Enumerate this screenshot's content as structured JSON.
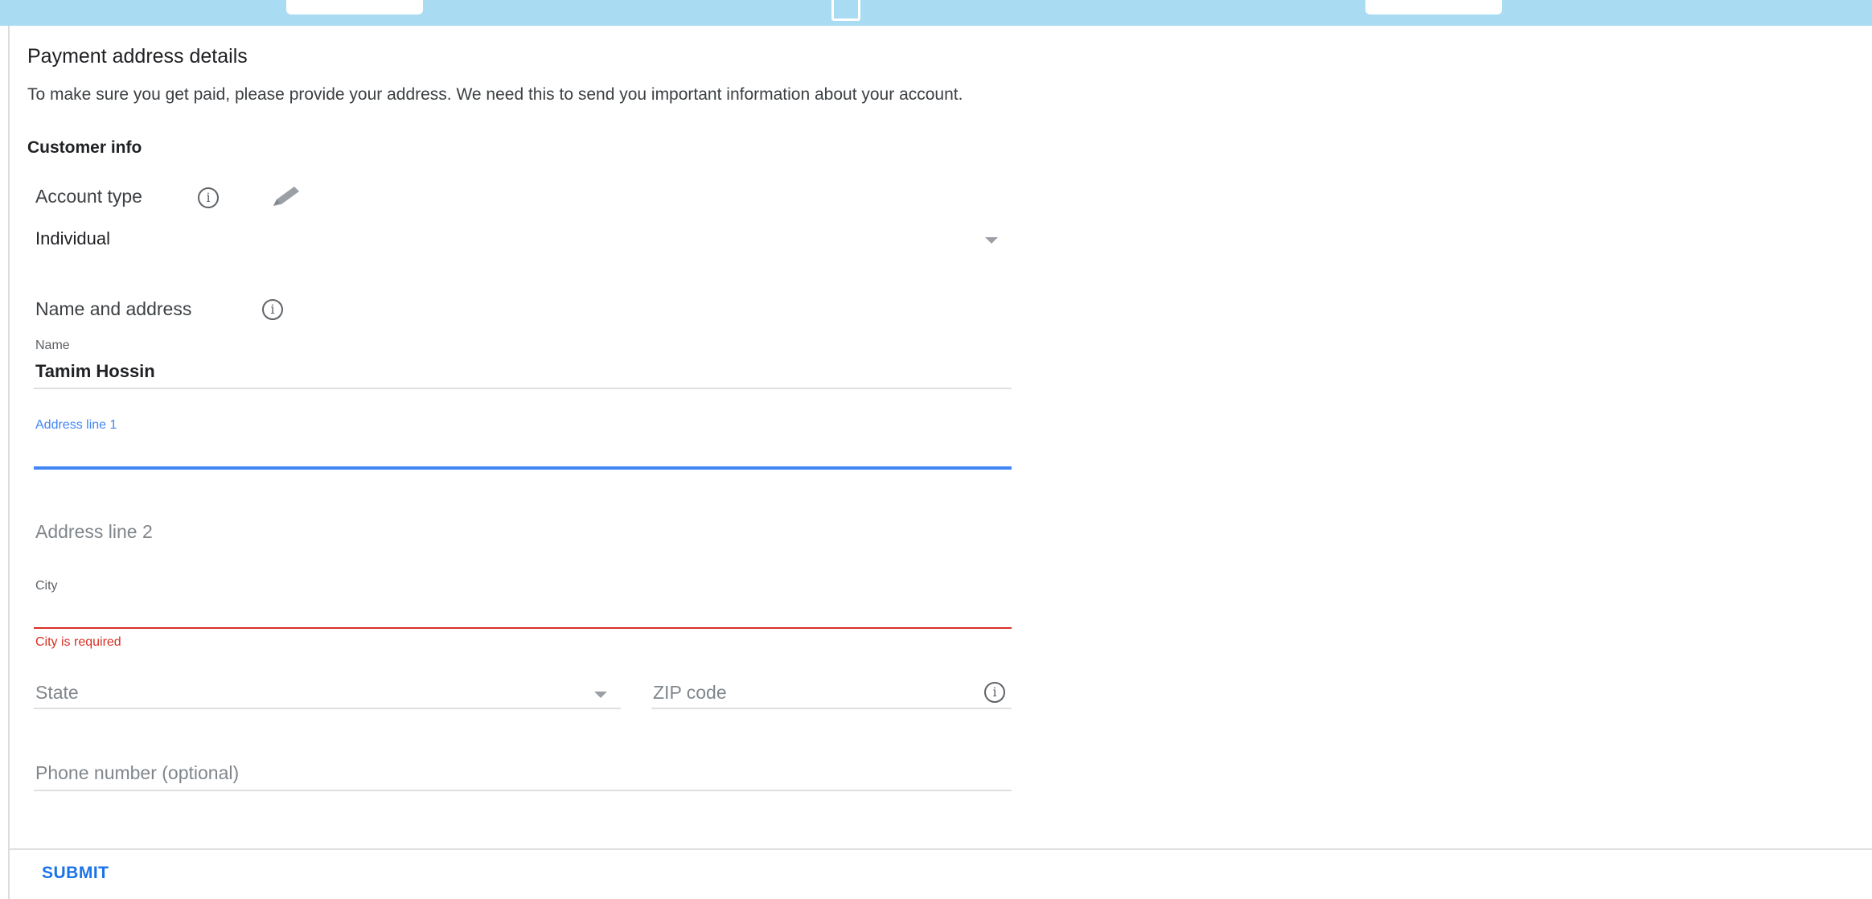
{
  "header": {
    "title": "Payment address details",
    "description": "To make sure you get paid, please provide your address. We need this to send you important information about your account."
  },
  "customer_info": {
    "heading": "Customer info",
    "account_type": {
      "label": "Account type",
      "selected": "Individual"
    }
  },
  "name_and_address": {
    "heading": "Name and address",
    "name": {
      "label": "Name",
      "value": "Tamim Hossin"
    },
    "address_line_1": {
      "label": "Address line 1",
      "value": ""
    },
    "address_line_2": {
      "placeholder": "Address line 2"
    },
    "city": {
      "label": "City",
      "value": "",
      "error": "City is required"
    },
    "state": {
      "placeholder": "State"
    },
    "zip": {
      "placeholder": "ZIP code"
    },
    "phone": {
      "placeholder": "Phone number (optional)"
    }
  },
  "footer": {
    "submit_label": "SUBMIT"
  },
  "colors": {
    "accent": "#4285f4",
    "error": "#d93025",
    "banner": "#a9dcf3",
    "button_text": "#1a73e8"
  },
  "icons": [
    "info-icon",
    "pencil-icon",
    "dropdown-caret-icon"
  ]
}
